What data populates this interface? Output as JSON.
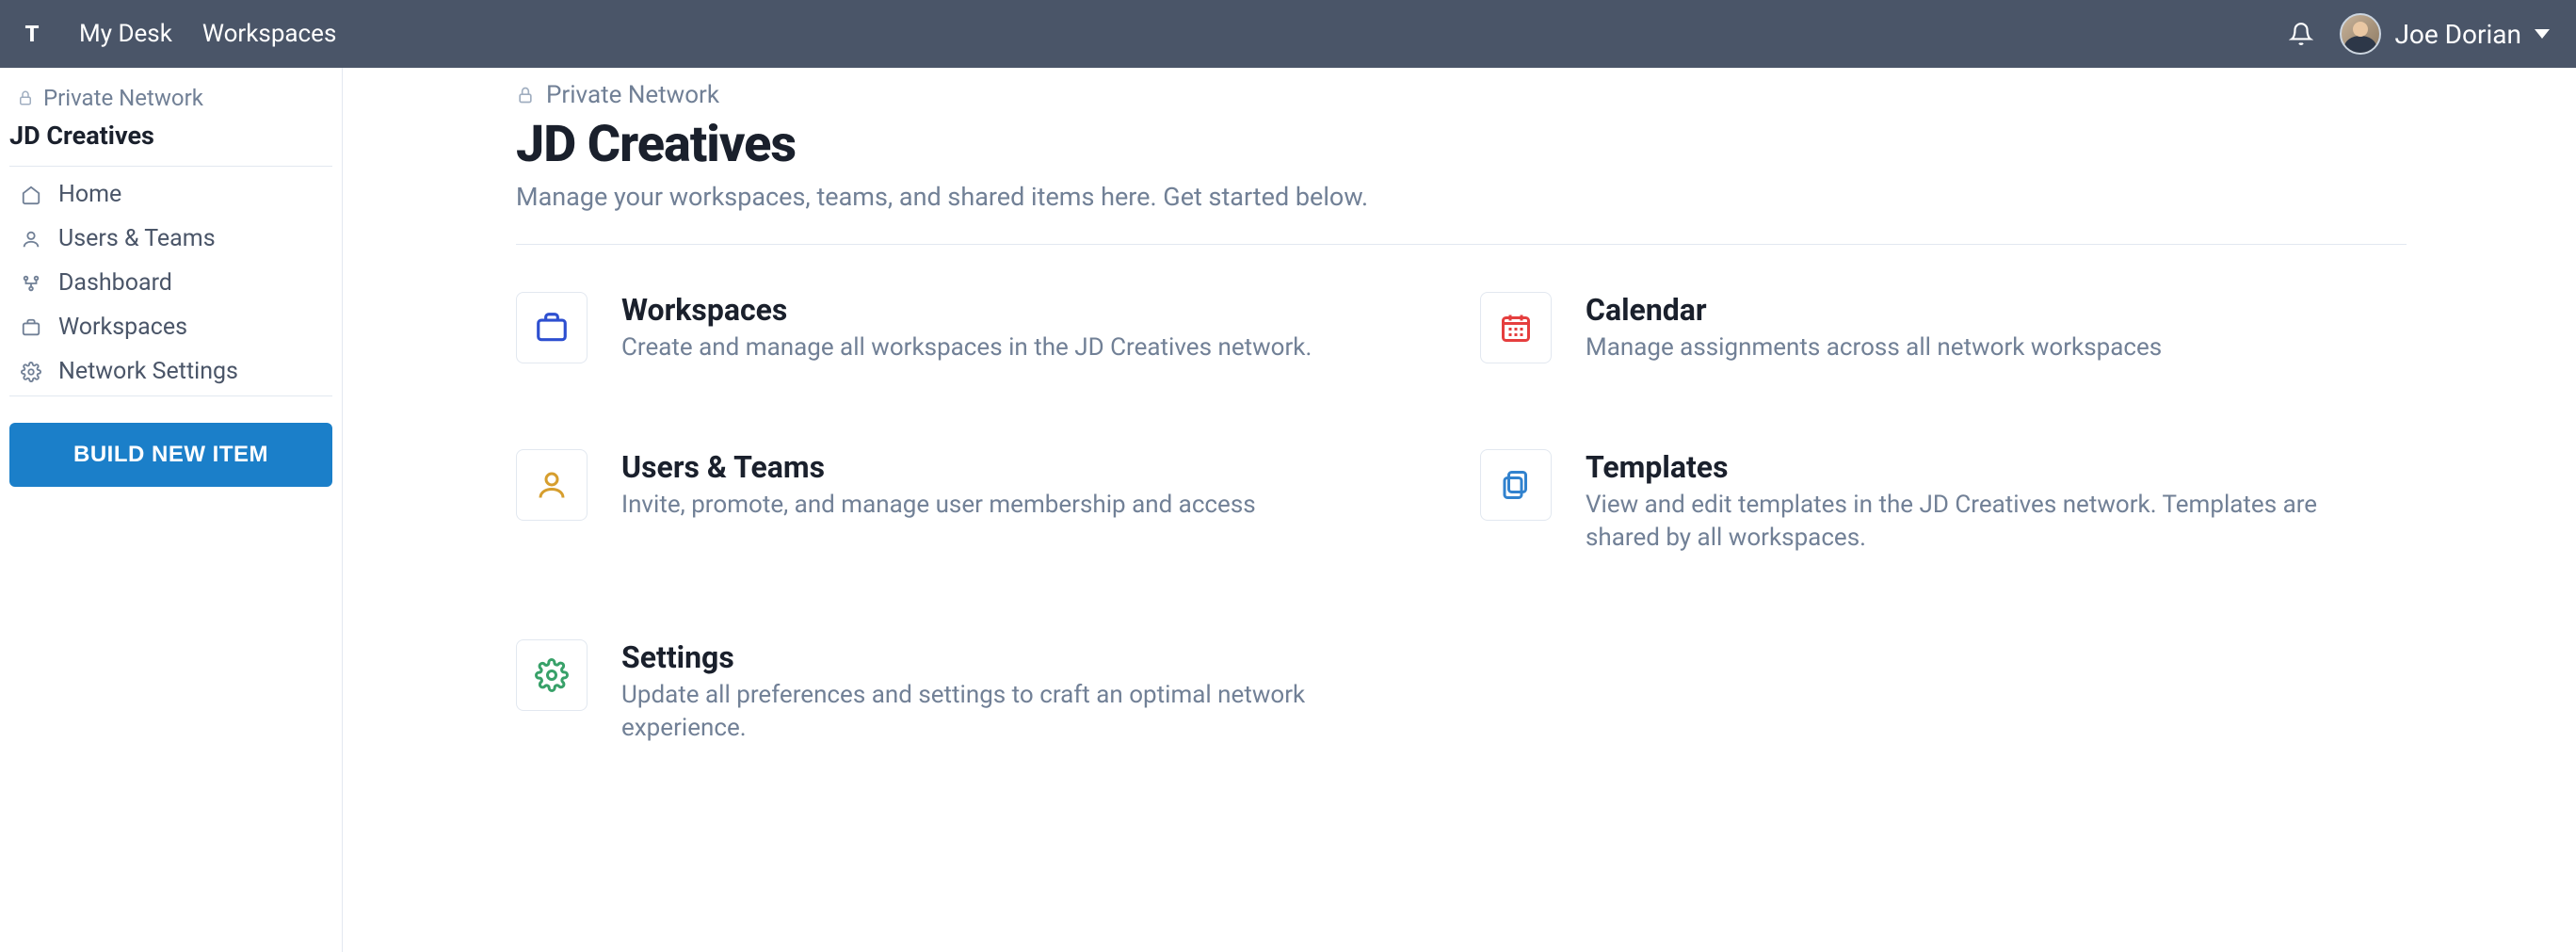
{
  "topnav": {
    "logo_letter": "T",
    "links": [
      "My Desk",
      "Workspaces"
    ],
    "user_name": "Joe Dorian"
  },
  "sidebar": {
    "network_label": "Private Network",
    "title": "JD Creatives",
    "items": [
      {
        "icon": "home-icon",
        "label": "Home"
      },
      {
        "icon": "user-icon",
        "label": "Users & Teams"
      },
      {
        "icon": "dashboard-icon",
        "label": "Dashboard"
      },
      {
        "icon": "briefcase-icon",
        "label": "Workspaces"
      },
      {
        "icon": "gear-icon",
        "label": "Network Settings"
      }
    ],
    "build_label": "BUILD NEW ITEM"
  },
  "main": {
    "network_label": "Private Network",
    "title": "JD Creatives",
    "sub": "Manage your workspaces, teams, and shared items here. Get started below.",
    "cards": [
      {
        "title": "Workspaces",
        "desc": "Create and manage all workspaces in the JD Creatives network.",
        "icon": "briefcase",
        "color": "#2d4fd0"
      },
      {
        "title": "Calendar",
        "desc": "Manage assignments across all network workspaces",
        "icon": "calendar",
        "color": "#e53e3e"
      },
      {
        "title": "Users & Teams",
        "desc": "Invite, promote, and manage user membership and access",
        "icon": "user",
        "color": "#d69e2e"
      },
      {
        "title": "Templates",
        "desc": "View and edit templates in the JD Creatives network. Templates are shared by all workspaces.",
        "icon": "templates",
        "color": "#3182ce"
      },
      {
        "title": "Settings",
        "desc": "Update all preferences and settings to craft an optimal network experience.",
        "icon": "gear",
        "color": "#38a169"
      }
    ]
  }
}
